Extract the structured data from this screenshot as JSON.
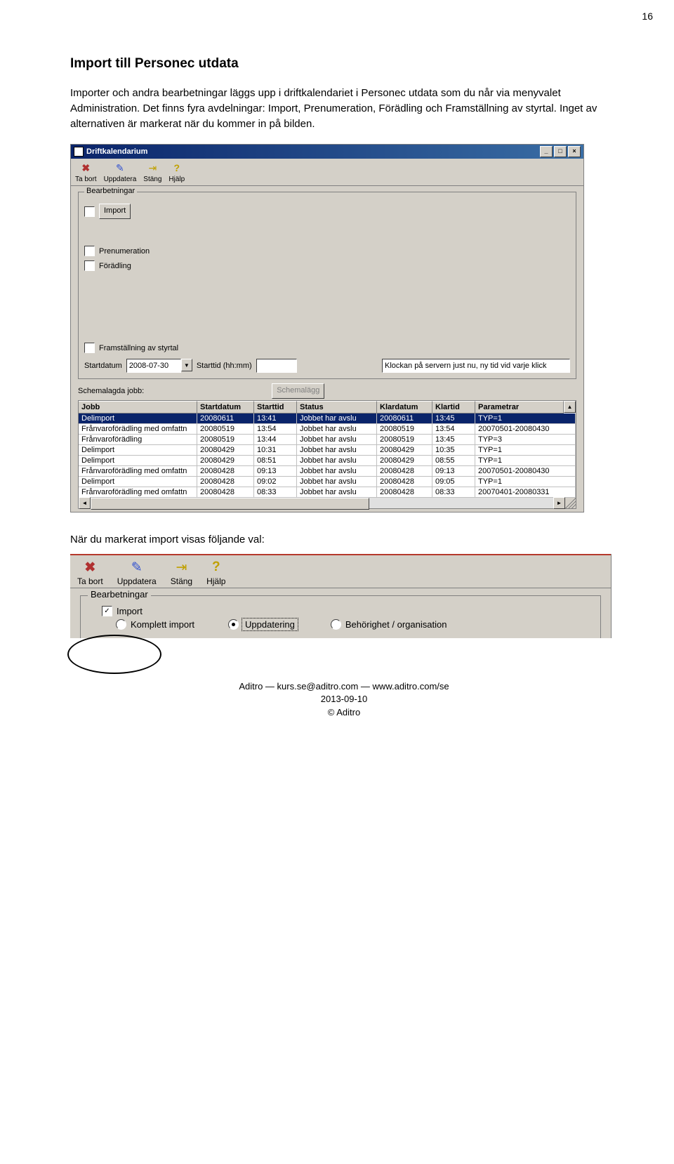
{
  "page_number": "16",
  "heading": "Import till Personec utdata",
  "para1": "Importer och andra bearbetningar läggs upp i driftkalendariet i Personec utdata som du når via menyvalet Administration. Det finns fyra avdelningar: Import, Prenumeration, Förädling och Framställning av styrtal. Inget av alternativen är markerat när du kommer in på bilden.",
  "win": {
    "title": "Driftkalendarium",
    "toolbar": [
      {
        "icon": "✖",
        "color": "#b03030",
        "label": "Ta bort"
      },
      {
        "icon": "✎",
        "color": "#3050d0",
        "label": "Uppdatera"
      },
      {
        "icon": "⇥",
        "color": "#c0a000",
        "label": "Stäng"
      },
      {
        "icon": "?",
        "color": "#c0a000",
        "label": "Hjälp"
      }
    ],
    "group_legend": "Bearbetningar",
    "chk_import": "Import",
    "chk_prenum": "Prenumeration",
    "chk_foradling": "Förädling",
    "chk_framst": "Framställning av styrtal",
    "startdatum_label": "Startdatum",
    "startdatum_value": "2008-07-30",
    "starttid_label": "Starttid (hh:mm)",
    "server_hint": "Klockan på servern just nu, ny tid vid varje klick",
    "schemalagda_label": "Schemalagda jobb:",
    "schemalagg_btn": "Schemalägg",
    "columns": [
      "Jobb",
      "Startdatum",
      "Starttid",
      "Status",
      "Klardatum",
      "Klartid",
      "Parametrar"
    ],
    "rows": [
      [
        "Delimport",
        "20080611",
        "13:41",
        "Jobbet har avslu",
        "20080611",
        "13:45",
        "TYP=1"
      ],
      [
        "Frånvaroförädling med omfattn",
        "20080519",
        "13:54",
        "Jobbet har avslu",
        "20080519",
        "13:54",
        "20070501-20080430"
      ],
      [
        "Frånvaroförädling",
        "20080519",
        "13:44",
        "Jobbet har avslu",
        "20080519",
        "13:45",
        "TYP=3"
      ],
      [
        "Delimport",
        "20080429",
        "10:31",
        "Jobbet har avslu",
        "20080429",
        "10:35",
        "TYP=1"
      ],
      [
        "Delimport",
        "20080429",
        "08:51",
        "Jobbet har avslu",
        "20080429",
        "08:55",
        "TYP=1"
      ],
      [
        "Frånvaroförädling med omfattn",
        "20080428",
        "09:13",
        "Jobbet har avslu",
        "20080428",
        "09:13",
        "20070501-20080430"
      ],
      [
        "Delimport",
        "20080428",
        "09:02",
        "Jobbet har avslu",
        "20080428",
        "09:05",
        "TYP=1"
      ],
      [
        "Frånvaroförädling med omfattn",
        "20080428",
        "08:33",
        "Jobbet har avslu",
        "20080428",
        "08:33",
        "20070401-20080331"
      ]
    ]
  },
  "sec2_title": "När du markerat import visas följande val:",
  "win2": {
    "toolbar": [
      {
        "icon": "✖",
        "color": "#b03030",
        "label": "Ta bort"
      },
      {
        "icon": "✎",
        "color": "#3050d0",
        "label": "Uppdatera"
      },
      {
        "icon": "⇥",
        "color": "#c0a000",
        "label": "Stäng"
      },
      {
        "icon": "?",
        "color": "#c0a000",
        "label": "Hjälp"
      }
    ],
    "group_legend": "Bearbetningar",
    "chk_import": "Import",
    "radio1": "Komplett import",
    "radio2": "Uppdatering",
    "radio3": "Behörighet / organisation"
  },
  "footer_line1": "Aditro  —  kurs.se@aditro.com  —  www.aditro.com/se",
  "footer_line2": "2013-09-10",
  "footer_line3": "© Aditro"
}
